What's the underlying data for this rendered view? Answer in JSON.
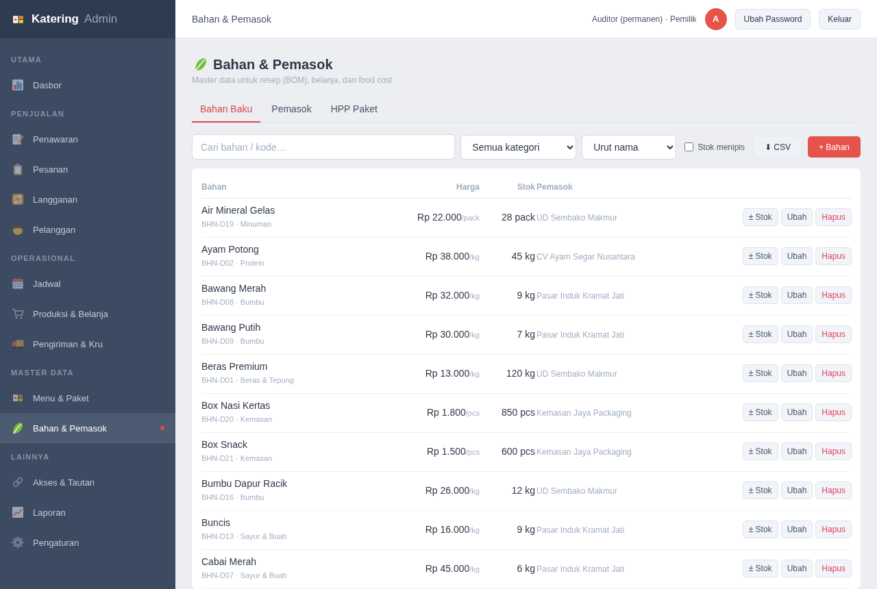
{
  "sidebar": {
    "brand": {
      "name": "Katering",
      "suffix": "Admin"
    },
    "sections": [
      {
        "label": "UTAMA",
        "items": [
          {
            "label": "Dasbor",
            "selected": false
          }
        ]
      },
      {
        "label": "PENJUALAN",
        "items": [
          {
            "label": "Penawaran",
            "selected": false
          },
          {
            "label": "Pesanan",
            "selected": false
          },
          {
            "label": "Langganan",
            "selected": false
          },
          {
            "label": "Pelanggan",
            "selected": false
          }
        ]
      },
      {
        "label": "OPERASIONAL",
        "items": [
          {
            "label": "Jadwal",
            "selected": false
          },
          {
            "label": "Produksi & Belanja",
            "selected": false
          },
          {
            "label": "Pengiriman & Kru",
            "selected": false
          }
        ]
      },
      {
        "label": "MASTER DATA",
        "items": [
          {
            "label": "Menu & Paket",
            "selected": false
          },
          {
            "label": "Bahan & Pemasok",
            "selected": true
          }
        ]
      },
      {
        "label": "LAINNYA",
        "items": [
          {
            "label": "Akses & Tautan",
            "selected": false
          },
          {
            "label": "Laporan",
            "selected": false
          },
          {
            "label": "Pengaturan",
            "selected": false
          }
        ]
      }
    ]
  },
  "topbar": {
    "breadcrumb": "Bahan & Pemasok",
    "user": "Auditor (permanen) · Pemilik",
    "avatar": "A",
    "buttons": [
      "Ubah Password",
      "Keluar"
    ]
  },
  "page": {
    "title": "Bahan & Pemasok",
    "subtitle": "Master data untuk resep (BOM), belanja, dan food cost",
    "tabs": [
      {
        "label": "Bahan Baku",
        "selected": true
      },
      {
        "label": "Pemasok",
        "selected": false
      },
      {
        "label": "HPP Paket",
        "selected": false
      }
    ]
  },
  "toolbar": {
    "search": {
      "placeholder": "Cari bahan / kode…"
    },
    "category_select": "Semua kategori",
    "sort_select": "Urut nama",
    "low_stock_filter": {
      "label": "Stok menipis",
      "checked": false
    },
    "csv_button": "⬇ CSV",
    "add_button": "+ Bahan"
  },
  "table": {
    "columns": [
      "Bahan",
      "Harga",
      "Stok",
      "Pemasok"
    ],
    "rows": [
      {
        "name": "Air Mineral Gelas",
        "code": "BHN-D19 · Minuman",
        "price": "Rp 22.000",
        "unit": "/pack",
        "stock": "28 pack",
        "supplier": "UD Sembako Makmur",
        "actions": [
          {
            "label": "± Stok",
            "kind": "default"
          },
          {
            "label": "Ubah",
            "kind": "default"
          },
          {
            "label": "Hapus",
            "kind": "danger"
          }
        ]
      },
      {
        "name": "Ayam Potong",
        "code": "BHN-D02 · Protein",
        "price": "Rp 38.000",
        "unit": "/kg",
        "stock": "45 kg",
        "supplier": "CV Ayam Segar Nusantara",
        "actions": [
          {
            "label": "± Stok",
            "kind": "default"
          },
          {
            "label": "Ubah",
            "kind": "default"
          },
          {
            "label": "Hapus",
            "kind": "danger"
          }
        ]
      },
      {
        "name": "Bawang Merah",
        "code": "BHN-D08 · Bumbu",
        "price": "Rp 32.000",
        "unit": "/kg",
        "stock": "9 kg",
        "supplier": "Pasar Induk Kramat Jati",
        "actions": [
          {
            "label": "± Stok",
            "kind": "default"
          },
          {
            "label": "Ubah",
            "kind": "default"
          },
          {
            "label": "Hapus",
            "kind": "danger"
          }
        ]
      },
      {
        "name": "Bawang Putih",
        "code": "BHN-D09 · Bumbu",
        "price": "Rp 30.000",
        "unit": "/kg",
        "stock": "7 kg",
        "supplier": "Pasar Induk Kramat Jati",
        "actions": [
          {
            "label": "± Stok",
            "kind": "default"
          },
          {
            "label": "Ubah",
            "kind": "default"
          },
          {
            "label": "Hapus",
            "kind": "danger"
          }
        ]
      },
      {
        "name": "Beras Premium",
        "code": "BHN-D01 · Beras & Tepung",
        "price": "Rp 13.000",
        "unit": "/kg",
        "stock": "120 kg",
        "supplier": "UD Sembako Makmur",
        "actions": [
          {
            "label": "± Stok",
            "kind": "default"
          },
          {
            "label": "Ubah",
            "kind": "default"
          },
          {
            "label": "Hapus",
            "kind": "danger"
          }
        ]
      },
      {
        "name": "Box Nasi Kertas",
        "code": "BHN-D20 · Kemasan",
        "price": "Rp 1.800",
        "unit": "/pcs",
        "stock": "850 pcs",
        "supplier": "Kemasan Jaya Packaging",
        "actions": [
          {
            "label": "± Stok",
            "kind": "default"
          },
          {
            "label": "Ubah",
            "kind": "default"
          },
          {
            "label": "Hapus",
            "kind": "danger"
          }
        ]
      },
      {
        "name": "Box Snack",
        "code": "BHN-D21 · Kemasan",
        "price": "Rp 1.500",
        "unit": "/pcs",
        "stock": "600 pcs",
        "supplier": "Kemasan Jaya Packaging",
        "actions": [
          {
            "label": "± Stok",
            "kind": "default"
          },
          {
            "label": "Ubah",
            "kind": "default"
          },
          {
            "label": "Hapus",
            "kind": "danger"
          }
        ]
      },
      {
        "name": "Bumbu Dapur Racik",
        "code": "BHN-D16 · Bumbu",
        "price": "Rp 26.000",
        "unit": "/kg",
        "stock": "12 kg",
        "supplier": "UD Sembako Makmur",
        "actions": [
          {
            "label": "± Stok",
            "kind": "default"
          },
          {
            "label": "Ubah",
            "kind": "default"
          },
          {
            "label": "Hapus",
            "kind": "danger"
          }
        ]
      },
      {
        "name": "Buncis",
        "code": "BHN-D13 · Sayur & Buah",
        "price": "Rp 16.000",
        "unit": "/kg",
        "stock": "9 kg",
        "supplier": "Pasar Induk Kramat Jati",
        "actions": [
          {
            "label": "± Stok",
            "kind": "default"
          },
          {
            "label": "Ubah",
            "kind": "default"
          },
          {
            "label": "Hapus",
            "kind": "danger"
          }
        ]
      },
      {
        "name": "Cabai Merah",
        "code": "BHN-D07 · Sayur & Buah",
        "price": "Rp 45.000",
        "unit": "/kg",
        "stock": "6 kg",
        "supplier": "Pasar Induk Kramat Jati",
        "actions": [
          {
            "label": "± Stok",
            "kind": "default"
          },
          {
            "label": "Ubah",
            "kind": "default"
          },
          {
            "label": "Hapus",
            "kind": "danger"
          }
        ]
      }
    ]
  }
}
